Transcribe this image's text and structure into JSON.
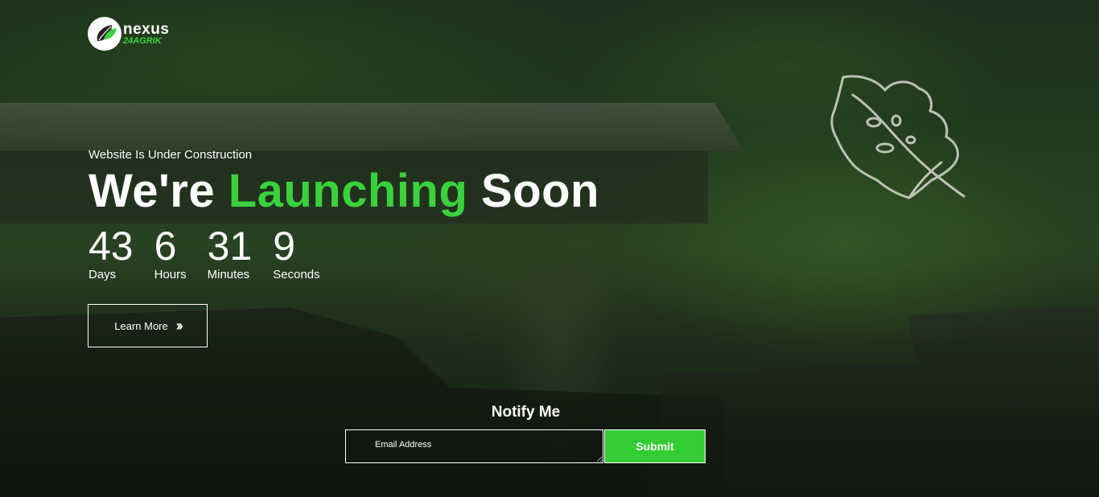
{
  "brand": {
    "name": "nexus",
    "sub": "24AGRIK",
    "accent_color": "#3ad13d",
    "logo_icon": "leaf-logo-icon"
  },
  "hero": {
    "tagline": "Website Is Under Construction",
    "headline_part1": "We're ",
    "headline_accent": "Launching",
    "headline_part2": " Soon",
    "decor_icon": "monstera-leaf-outline-icon"
  },
  "countdown": [
    {
      "value": "43",
      "label": "Days"
    },
    {
      "value": "6",
      "label": "Hours"
    },
    {
      "value": "31",
      "label": "Minutes"
    },
    {
      "value": "9",
      "label": "Seconds"
    }
  ],
  "learn_more": {
    "label": "Learn More",
    "icon": "double-chevron-right-icon"
  },
  "notify": {
    "title": "Notify Me",
    "email_placeholder": "Email Address",
    "submit_label": "Submit",
    "submit_color": "#33cc33"
  }
}
